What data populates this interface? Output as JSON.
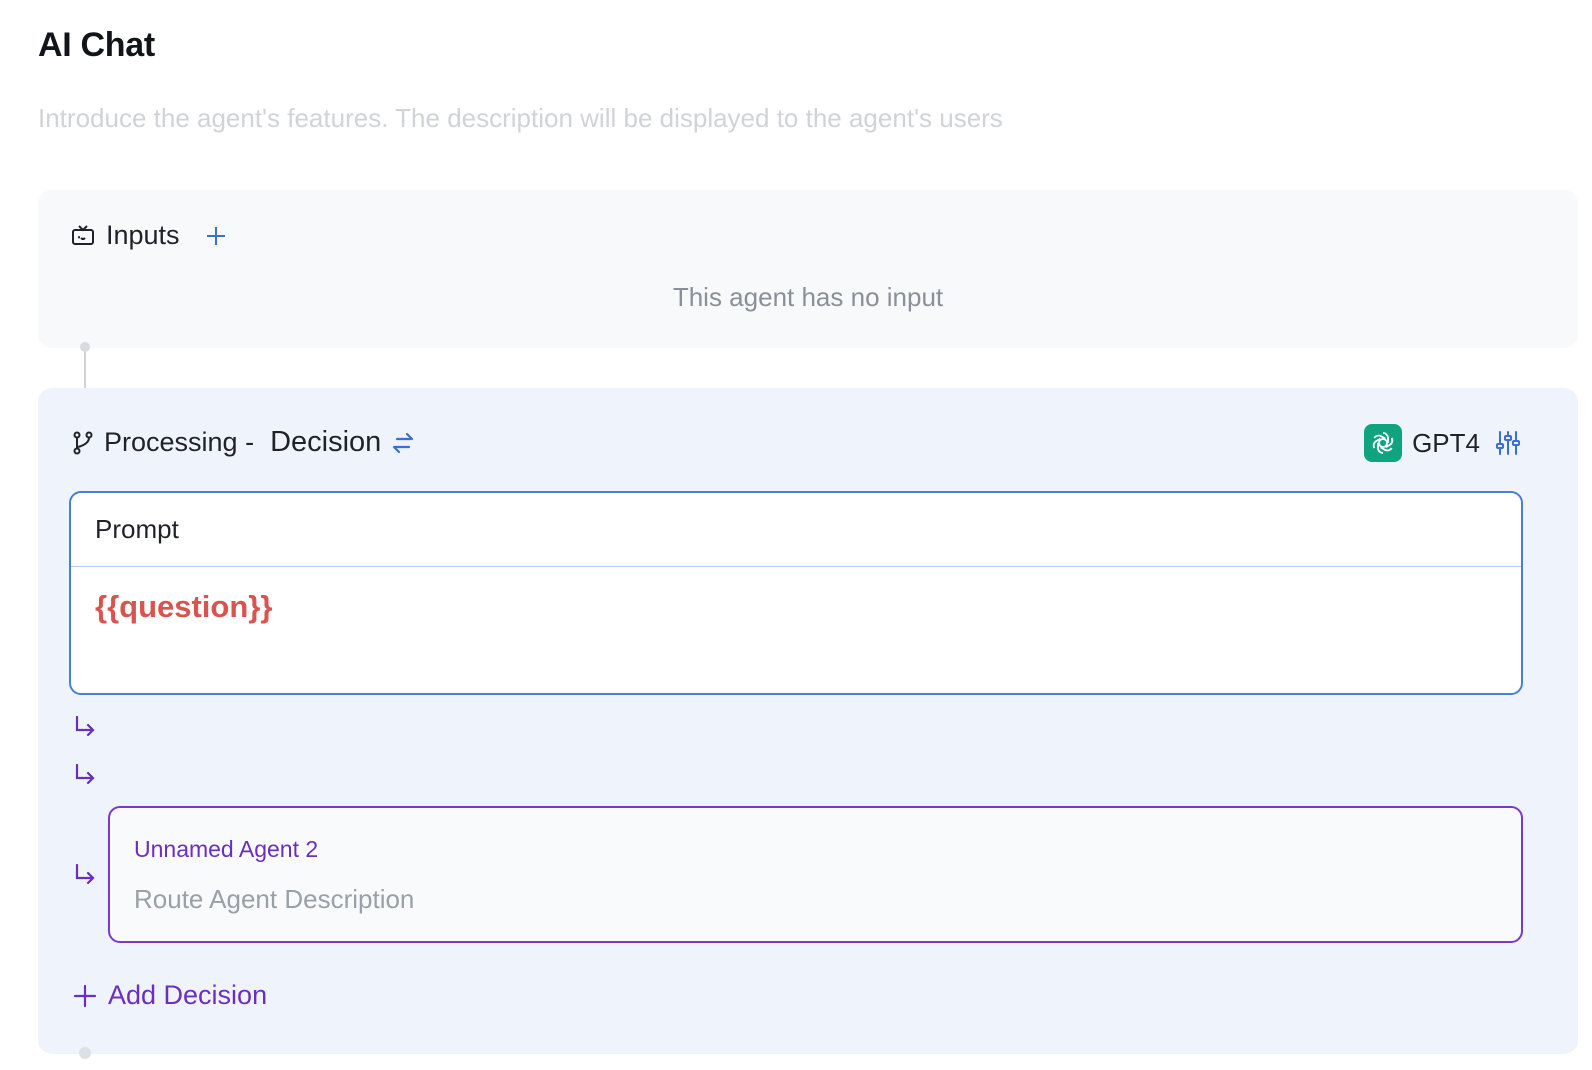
{
  "page": {
    "title": "AI Chat",
    "description_placeholder": "Introduce the agent's features. The description will be displayed to the agent's users"
  },
  "inputs": {
    "label": "Inputs",
    "empty_text": "This agent has no input"
  },
  "processing": {
    "label": "Processing -",
    "mode": "Decision",
    "model": "GPT4",
    "prompt": {
      "label": "Prompt",
      "value": "{{question}}"
    },
    "routes": [
      {
        "name": "",
        "description": ""
      },
      {
        "name": "",
        "description": ""
      },
      {
        "name": "Unnamed Agent 2",
        "description": "Route Agent Description"
      }
    ],
    "add_decision_label": "Add Decision"
  },
  "colors": {
    "accent_blue": "#4a7fd6",
    "accent_purple": "#6a2fc0",
    "variable_red": "#d9534f",
    "model_green": "#10a37f"
  },
  "icons": {
    "inputs": "robot-icon",
    "add": "plus-icon",
    "processing": "branch-icon",
    "swap": "swap-arrows-icon",
    "model": "openai-logo-icon",
    "settings": "sliders-icon",
    "route": "return-arrow-icon"
  }
}
